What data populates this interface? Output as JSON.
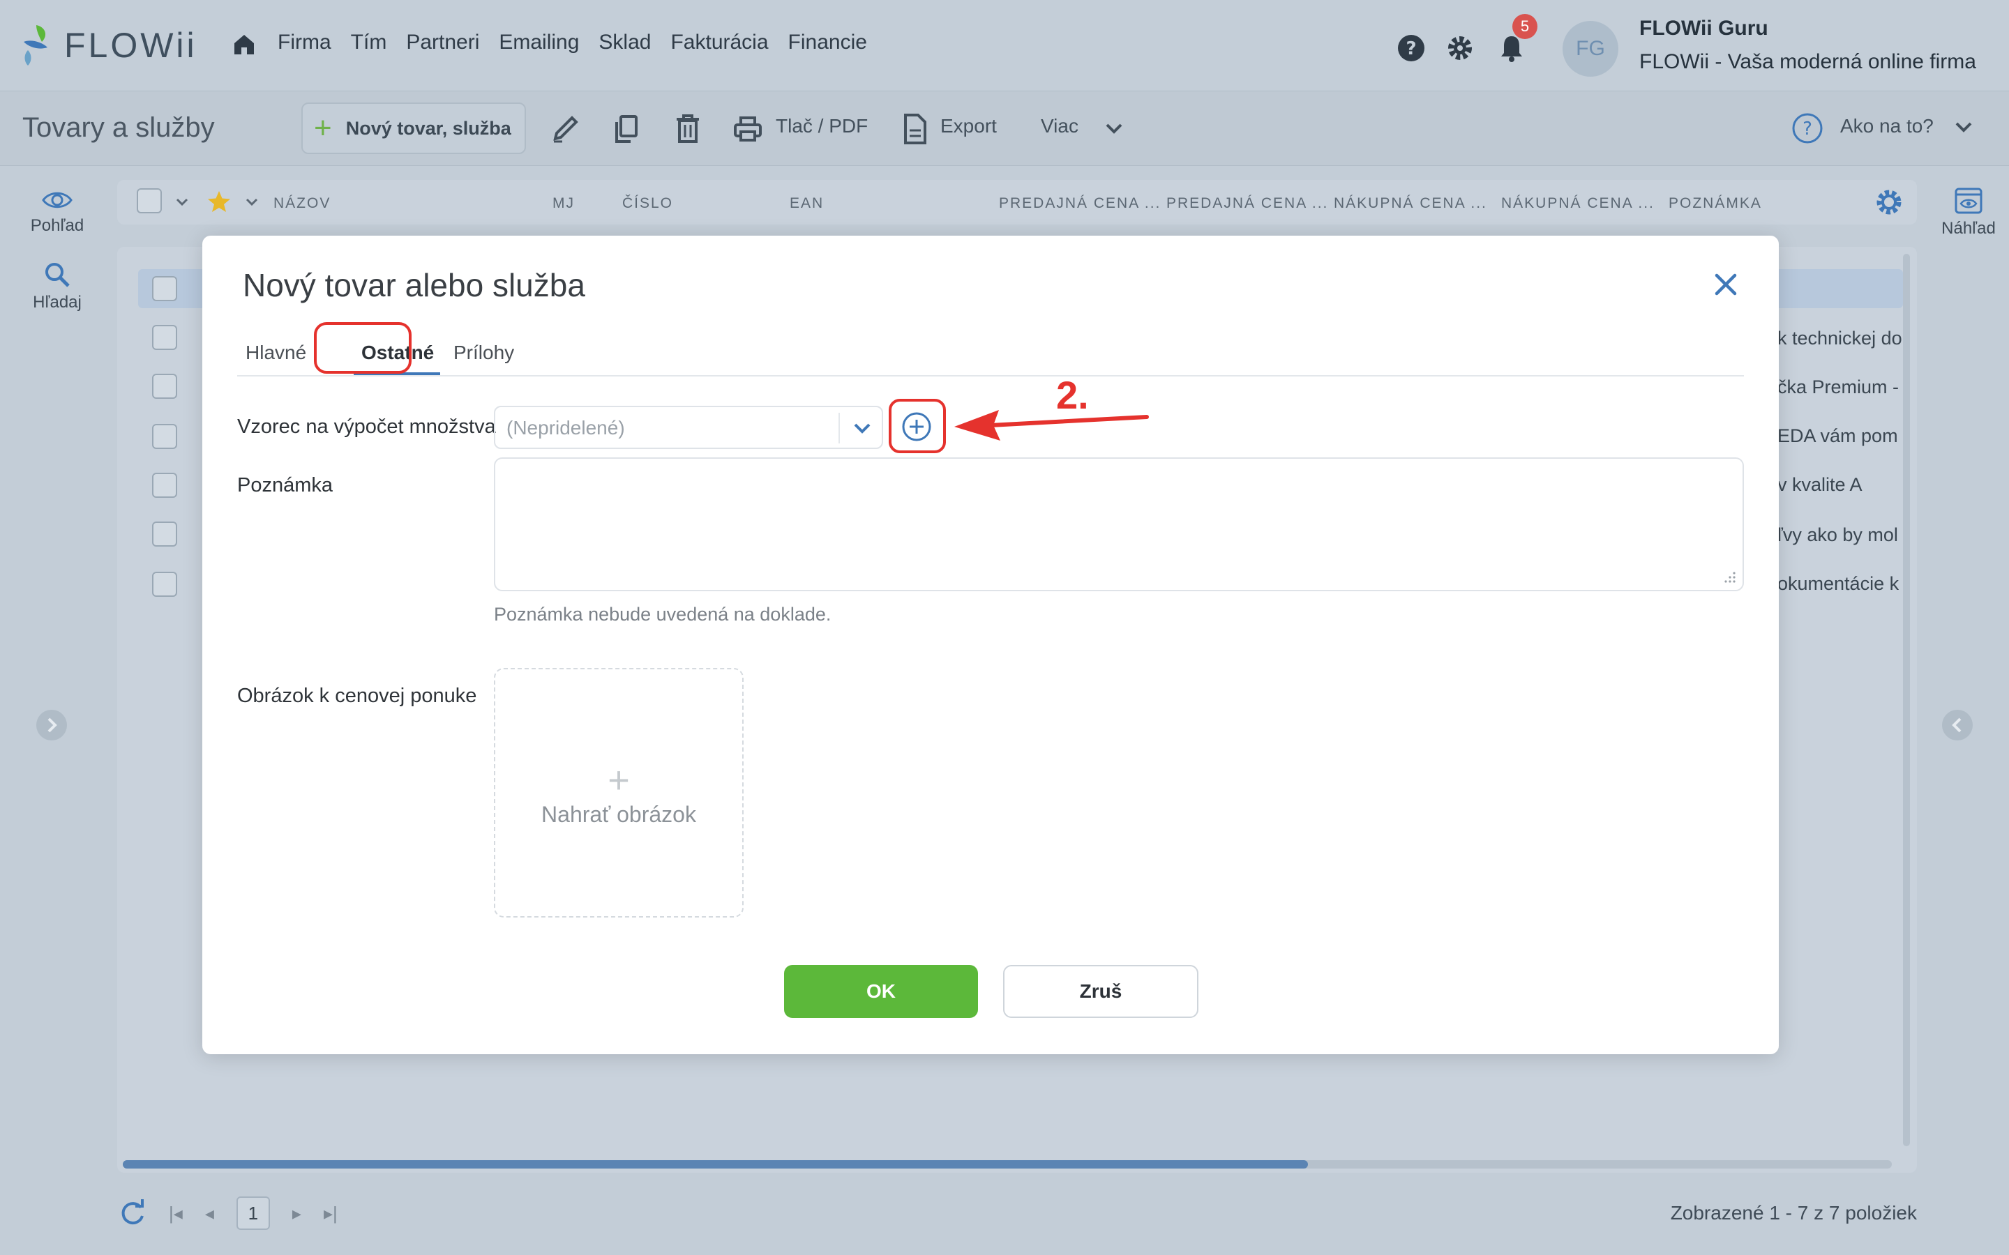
{
  "app": {
    "logo_text": "FLOWii",
    "nav": [
      "Firma",
      "Tím",
      "Partneri",
      "Emailing",
      "Sklad",
      "Fakturácia",
      "Financie"
    ],
    "notifications_count": "5",
    "avatar_initials": "FG",
    "user_name": "FLOWii Guru",
    "company": "FLOWii - Vaša moderná online firma"
  },
  "toolbar": {
    "page_title": "Tovary a služby",
    "new_label": "Nový tovar, služba",
    "print_label": "Tlač / PDF",
    "export_label": "Export",
    "more_label": "Viac",
    "help_label": "Ako na to?"
  },
  "sidebar": {
    "view_label": "Pohľad",
    "search_label": "Hľadaj",
    "preview_label": "Náhľad"
  },
  "grid": {
    "columns": [
      "NÁZOV",
      "MJ",
      "ČÍSLO",
      "EAN",
      "PREDAJNÁ CENA ...",
      "PREDAJNÁ CENA ...",
      "NÁKUPNÁ CENA ...",
      "NÁKUPNÁ CENA ...",
      "POZNÁMKA"
    ],
    "row_notes": [
      "k technickej do",
      "čka Premium -",
      "EDA vám pom",
      "v kvalite A",
      "ľvy ako by mol",
      "okumentácie k"
    ],
    "pager_page": "1",
    "pager_info": "Zobrazené 1 - 7 z 7 položiek",
    "scroll_fraction": 0.67
  },
  "modal": {
    "title": "Nový tovar alebo služba",
    "tabs": [
      "Hlavné",
      "Ostatné",
      "Prílohy"
    ],
    "active_tab": "Ostatné",
    "formula_label": "Vzorec na výpočet množstva",
    "formula_value": "(Nepridelené)",
    "note_label": "Poznámka",
    "note_hint": "Poznámka nebude uvedená na doklade.",
    "image_label": "Obrázok k cenovej ponuke",
    "upload_label": "Nahrať obrázok",
    "ok_label": "OK",
    "cancel_label": "Zruš",
    "annotation": "2."
  },
  "colors": {
    "accent": "#3f78b8",
    "ok_green": "#5cb83a",
    "annotation_red": "#e5322d"
  }
}
